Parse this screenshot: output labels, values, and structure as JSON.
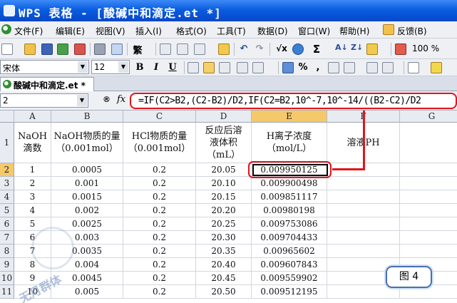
{
  "window": {
    "title": "WPS 表格 - [酸碱中和滴定.et *]"
  },
  "menu": {
    "items": [
      "文件(F)",
      "编辑(E)",
      "视图(V)",
      "插入(I)",
      "格式(O)",
      "工具(T)",
      "数据(D)",
      "窗口(W)",
      "帮助(H)",
      "反馈(B)"
    ]
  },
  "toolbar": {
    "traditional_label": "繁",
    "zoom": "100 %"
  },
  "format_toolbar": {
    "font": "宋体",
    "size": "12",
    "bold": "B",
    "italic": "I",
    "underline": "U"
  },
  "doc_tab": {
    "label": "酸碱中和滴定.et *"
  },
  "formula_bar": {
    "name_box": "2",
    "formula": "=IF(C2>B2,(C2-B2)/D2,IF(C2=B2,10^-7,10^-14/((B2-C2)/D2"
  },
  "sheet": {
    "columns": [
      "A",
      "B",
      "C",
      "D",
      "E",
      "F",
      "G"
    ],
    "header_row": {
      "row_num": "1",
      "A": [
        "NaOH",
        "滴数"
      ],
      "B": [
        "NaOH物质的量",
        "（0.001mol）"
      ],
      "C": [
        "HCl物质的量",
        "（0.001mol）"
      ],
      "D": [
        "反应后溶",
        "液体积",
        "（mL）"
      ],
      "E": [
        "H离子浓度",
        "（mol/L）"
      ],
      "F": [
        "溶液PH"
      ],
      "G": [
        ""
      ]
    },
    "rows": [
      {
        "n": "2",
        "A": "1",
        "B": "0.0005",
        "C": "0.2",
        "D": "20.05",
        "E": "0.009950125"
      },
      {
        "n": "3",
        "A": "2",
        "B": "0.001",
        "C": "0.2",
        "D": "20.10",
        "E": "0.009900498"
      },
      {
        "n": "4",
        "A": "3",
        "B": "0.0015",
        "C": "0.2",
        "D": "20.15",
        "E": "0.009851117"
      },
      {
        "n": "5",
        "A": "4",
        "B": "0.002",
        "C": "0.2",
        "D": "20.20",
        "E": "0.00980198"
      },
      {
        "n": "6",
        "A": "5",
        "B": "0.0025",
        "C": "0.2",
        "D": "20.25",
        "E": "0.009753086"
      },
      {
        "n": "7",
        "A": "6",
        "B": "0.003",
        "C": "0.2",
        "D": "20.30",
        "E": "0.009704433"
      },
      {
        "n": "8",
        "A": "7",
        "B": "0.0035",
        "C": "0.2",
        "D": "20.35",
        "E": "0.00965602"
      },
      {
        "n": "9",
        "A": "8",
        "B": "0.004",
        "C": "0.2",
        "D": "20.40",
        "E": "0.009607843"
      },
      {
        "n": "10",
        "A": "9",
        "B": "0.0045",
        "C": "0.2",
        "D": "20.45",
        "E": "0.009559902"
      },
      {
        "n": "11",
        "A": "10",
        "B": "0.005",
        "C": "0.2",
        "D": "20.50",
        "E": "0.009512195"
      }
    ]
  },
  "figure_label": "图 4",
  "watermark": {
    "text": "无月群体",
    "icon": "watermark-logo-icon"
  },
  "colors": {
    "title_blue": "#0a5de0",
    "highlight_red": "#e0141c",
    "selected_header": "#f5c96a"
  }
}
